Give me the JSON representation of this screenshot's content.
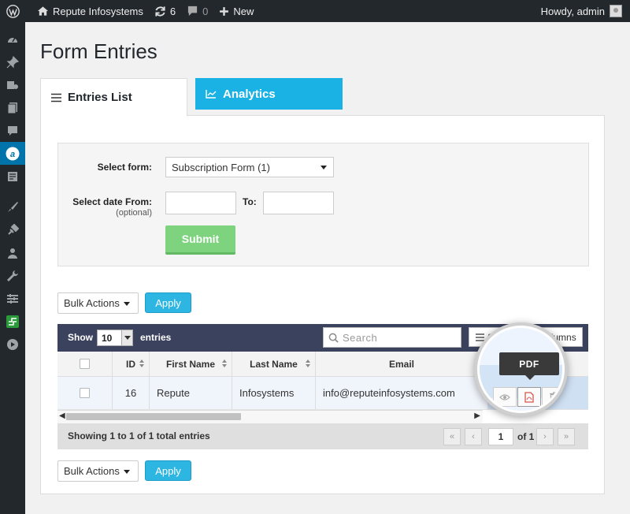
{
  "adminbar": {
    "site_name": "Repute Infosystems",
    "updates_count": "6",
    "comments_count": "0",
    "new_label": "New",
    "greeting": "Howdy, admin"
  },
  "sidebar": {
    "items": [
      "dashboard-icon",
      "pin-icon",
      "media-icon",
      "pages-icon",
      "comments-icon",
      "arforms-icon",
      "forms-icon",
      "appearance-icon",
      "plugins-icon",
      "users-icon",
      "tools-icon",
      "settings-icon",
      "plugin-icon",
      "play-icon"
    ],
    "active_index": 5
  },
  "page": {
    "title": "Form Entries"
  },
  "tabs": [
    {
      "label": "Entries List",
      "icon": "list-icon",
      "active": true
    },
    {
      "label": "Analytics",
      "icon": "chart-icon",
      "active": false
    }
  ],
  "filter": {
    "select_form_label": "Select form:",
    "select_form_value": "Subscription Form (1)",
    "date_from_label": "Select date From:",
    "date_from_sub": "(optional)",
    "date_from_value": "",
    "to_label": "To:",
    "to_value": "",
    "submit_label": "Submit"
  },
  "bulk_top": {
    "label": "Bulk Actions",
    "apply": "Apply"
  },
  "bulk_bottom": {
    "label": "Bulk Actions",
    "apply": "Apply"
  },
  "table": {
    "show_label": "Show",
    "page_length": "10",
    "entries_label": "entries",
    "search_placeholder": "Search",
    "show_hide_label": "Show / Hide columns",
    "columns": [
      "ID",
      "First Name",
      "Last Name",
      "Email"
    ],
    "rows": [
      {
        "id": "16",
        "first_name": "Repute",
        "last_name": "Infosystems",
        "email": "info@reputeinfosystems.com"
      }
    ],
    "info": "Showing 1 to 1 of 1 total entries",
    "page_current": "1",
    "page_of": "of 1"
  },
  "actions": {
    "tooltip": "PDF",
    "icons": [
      "eye-icon",
      "pdf-icon",
      "trash-icon"
    ]
  },
  "colors": {
    "accent": "#0073aa",
    "analytics_tab": "#1ab1e5",
    "submit": "#7ed37e",
    "apply": "#2eb6e3",
    "table_header": "#3b425e"
  }
}
